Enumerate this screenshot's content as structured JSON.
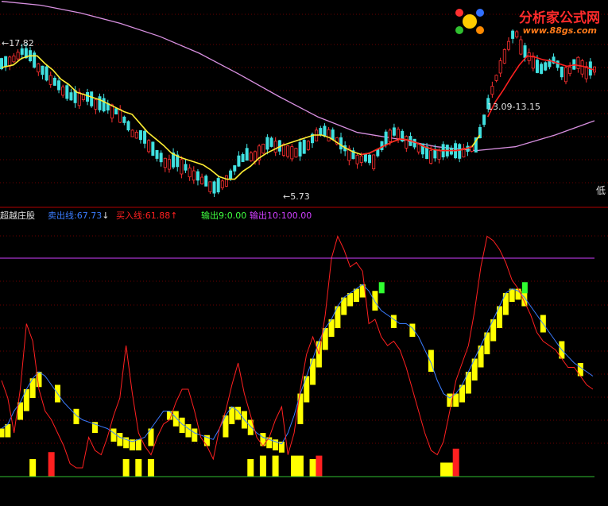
{
  "watermark": {
    "site_name": "分析家公式网",
    "url": "www.88gs.com"
  },
  "price_panel": {
    "high_label": "17.82",
    "low_label": "5.73",
    "range_label": "13.09-13.15",
    "right_edge_label": "低"
  },
  "indicator_panel": {
    "name": "超越庄股",
    "sell_line": "卖出线:67.73",
    "buy_line": "买入线:61.88",
    "output9": "输出9:0.00",
    "output10": "输出10:100.00",
    "colors": {
      "sell": "#3a7cff",
      "buy": "#ff2020",
      "output9": "#40ff40",
      "output10": "#d040ff"
    }
  },
  "chart_data": [
    {
      "type": "candlestick",
      "title": "",
      "n_bars": 146,
      "ylim": [
        5.0,
        19.5
      ],
      "annotations": {
        "high": 17.82,
        "low": 5.73,
        "range": "13.09-13.15"
      },
      "close_points": [
        [
          0,
          15.6
        ],
        [
          6,
          16.1
        ],
        [
          10,
          16.6
        ],
        [
          14,
          16.3
        ],
        [
          20,
          15.2
        ],
        [
          25,
          14.5
        ],
        [
          30,
          13.8
        ],
        [
          36,
          13.0
        ],
        [
          42,
          13.2
        ],
        [
          48,
          12.6
        ],
        [
          54,
          12.3
        ],
        [
          60,
          11.8
        ],
        [
          66,
          10.4
        ],
        [
          72,
          10.0
        ],
        [
          78,
          8.7
        ],
        [
          84,
          8.0
        ],
        [
          88,
          8.2
        ],
        [
          92,
          7.8
        ],
        [
          96,
          7.3
        ],
        [
          100,
          6.9
        ],
        [
          104,
          6.5
        ],
        [
          108,
          6.0
        ],
        [
          112,
          6.5
        ],
        [
          116,
          7.1
        ],
        [
          120,
          8.1
        ],
        [
          124,
          8.6
        ],
        [
          128,
          8.6
        ],
        [
          132,
          9.2
        ],
        [
          136,
          9.6
        ],
        [
          140,
          9.3
        ],
        [
          144,
          9.1
        ],
        [
          148,
          8.9
        ],
        [
          152,
          9.0
        ],
        [
          156,
          9.6
        ],
        [
          160,
          10.4
        ],
        [
          164,
          10.4
        ],
        [
          168,
          10.1
        ],
        [
          172,
          9.4
        ],
        [
          176,
          8.8
        ],
        [
          180,
          8.4
        ],
        [
          184,
          8.4
        ],
        [
          188,
          8.2
        ],
        [
          192,
          9.2
        ],
        [
          196,
          10.2
        ],
        [
          200,
          10.5
        ],
        [
          204,
          9.8
        ],
        [
          208,
          9.6
        ],
        [
          212,
          9.2
        ],
        [
          216,
          8.6
        ],
        [
          220,
          8.7
        ],
        [
          224,
          8.9
        ],
        [
          228,
          8.9
        ],
        [
          232,
          8.8
        ],
        [
          236,
          9.1
        ],
        [
          240,
          9.3
        ],
        [
          244,
          11.2
        ],
        [
          248,
          13.6
        ],
        [
          252,
          15.4
        ],
        [
          256,
          17.0
        ],
        [
          260,
          18.3
        ],
        [
          264,
          16.6
        ],
        [
          268,
          16.2
        ],
        [
          272,
          15.1
        ],
        [
          276,
          15.5
        ],
        [
          280,
          16.0
        ],
        [
          284,
          14.8
        ],
        [
          288,
          15.3
        ],
        [
          292,
          15.9
        ],
        [
          296,
          15.1
        ],
        [
          300,
          15.3
        ]
      ],
      "ma_short": [
        [
          0,
          15.4
        ],
        [
          6,
          15.6
        ],
        [
          10,
          16.1
        ],
        [
          14,
          16.3
        ],
        [
          18,
          16.3
        ],
        [
          22,
          15.7
        ],
        [
          26,
          15.2
        ],
        [
          30,
          14.5
        ],
        [
          34,
          14.1
        ],
        [
          38,
          13.5
        ],
        [
          42,
          13.3
        ],
        [
          46,
          13.1
        ],
        [
          50,
          12.9
        ],
        [
          54,
          12.6
        ],
        [
          58,
          12.3
        ],
        [
          62,
          12.0
        ],
        [
          66,
          11.8
        ],
        [
          70,
          11.1
        ],
        [
          74,
          10.4
        ],
        [
          78,
          9.9
        ],
        [
          82,
          9.4
        ],
        [
          86,
          8.8
        ],
        [
          90,
          8.5
        ],
        [
          94,
          8.3
        ],
        [
          98,
          8.1
        ],
        [
          102,
          7.9
        ],
        [
          106,
          7.5
        ],
        [
          110,
          7.0
        ],
        [
          114,
          6.8
        ],
        [
          118,
          6.8
        ],
        [
          122,
          7.4
        ],
        [
          126,
          7.8
        ],
        [
          130,
          8.4
        ],
        [
          134,
          8.8
        ],
        [
          138,
          9.1
        ],
        [
          142,
          9.4
        ],
        [
          146,
          9.6
        ],
        [
          150,
          9.8
        ],
        [
          154,
          10.0
        ],
        [
          158,
          10.2
        ],
        [
          162,
          10.2
        ],
        [
          166,
          10.0
        ],
        [
          170,
          9.6
        ],
        [
          174,
          9.2
        ],
        [
          178,
          8.9
        ],
        [
          182,
          8.7
        ],
        [
          186,
          8.8
        ],
        [
          190,
          9.1
        ],
        [
          194,
          9.4
        ],
        [
          198,
          9.7
        ],
        [
          202,
          9.9
        ],
        [
          206,
          9.8
        ],
        [
          210,
          9.6
        ],
        [
          214,
          9.3
        ],
        [
          218,
          9.1
        ],
        [
          222,
          9.0
        ],
        [
          226,
          9.0
        ],
        [
          230,
          9.0
        ],
        [
          234,
          9.1
        ],
        [
          238,
          9.3
        ],
        [
          242,
          10.2
        ],
        [
          246,
          11.6
        ],
        [
          250,
          12.8
        ],
        [
          254,
          13.7
        ],
        [
          258,
          14.7
        ],
        [
          262,
          15.6
        ],
        [
          266,
          16.3
        ],
        [
          270,
          16.2
        ],
        [
          274,
          16.0
        ],
        [
          278,
          15.9
        ],
        [
          282,
          15.7
        ],
        [
          286,
          15.5
        ],
        [
          290,
          15.6
        ],
        [
          294,
          15.5
        ],
        [
          298,
          15.3
        ],
        [
          300,
          15.2
        ]
      ],
      "ma_long": [
        [
          0,
          20.5
        ],
        [
          20,
          20.2
        ],
        [
          40,
          19.6
        ],
        [
          60,
          18.8
        ],
        [
          80,
          17.8
        ],
        [
          100,
          16.5
        ],
        [
          120,
          14.9
        ],
        [
          140,
          13.2
        ],
        [
          160,
          11.6
        ],
        [
          180,
          10.4
        ],
        [
          200,
          9.9
        ],
        [
          220,
          9.3
        ],
        [
          240,
          9.0
        ],
        [
          260,
          9.3
        ],
        [
          280,
          10.2
        ],
        [
          300,
          11.3
        ]
      ]
    },
    {
      "type": "line",
      "title": "超越庄股",
      "ylim": [
        0,
        120
      ],
      "reference_lines": [
        {
          "name": "输出9",
          "value": 0.0
        },
        {
          "name": "输出10",
          "value": 100.0
        }
      ],
      "series": [
        {
          "name": "卖出线",
          "color": "#3a7cff",
          "x_step": 1,
          "values": [
            22,
            24,
            30,
            34,
            40,
            45,
            48,
            46,
            42,
            38,
            34,
            31,
            28,
            26,
            25,
            24,
            23,
            22,
            20,
            18,
            17,
            16,
            17,
            18,
            22,
            26,
            30,
            30,
            27,
            24,
            22,
            20,
            19,
            18,
            17,
            22,
            28,
            32,
            30,
            26,
            23,
            20,
            18,
            17,
            16,
            15,
            20,
            28,
            38,
            46,
            54,
            62,
            68,
            72,
            78,
            82,
            84,
            86,
            88,
            85,
            80,
            76,
            74,
            72,
            70,
            70,
            68,
            64,
            58,
            52,
            44,
            38,
            36,
            38,
            42,
            48,
            54,
            60,
            66,
            72,
            78,
            84,
            86,
            85,
            82,
            78,
            74,
            70,
            66,
            62,
            58,
            55,
            52,
            50,
            48,
            46
          ]
        },
        {
          "name": "买入线",
          "color": "#ff2020",
          "x_step": 1,
          "values": [
            44,
            36,
            20,
            40,
            70,
            62,
            40,
            30,
            26,
            20,
            14,
            6,
            4,
            4,
            18,
            12,
            10,
            18,
            28,
            36,
            60,
            38,
            20,
            14,
            10,
            18,
            24,
            26,
            34,
            40,
            40,
            30,
            18,
            14,
            8,
            22,
            30,
            42,
            52,
            38,
            28,
            18,
            14,
            18,
            26,
            32,
            10,
            20,
            40,
            56,
            64,
            56,
            74,
            100,
            110,
            104,
            96,
            98,
            94,
            70,
            72,
            64,
            60,
            62,
            58,
            50,
            40,
            30,
            20,
            12,
            10,
            16,
            30,
            44,
            52,
            60,
            76,
            96,
            110,
            108,
            104,
            98,
            90,
            86,
            80,
            74,
            66,
            62,
            60,
            58,
            54,
            50,
            50,
            46,
            42,
            40
          ]
        }
      ],
      "bars_yellow": "stepped histogram values shown as yellow blocks"
    }
  ]
}
